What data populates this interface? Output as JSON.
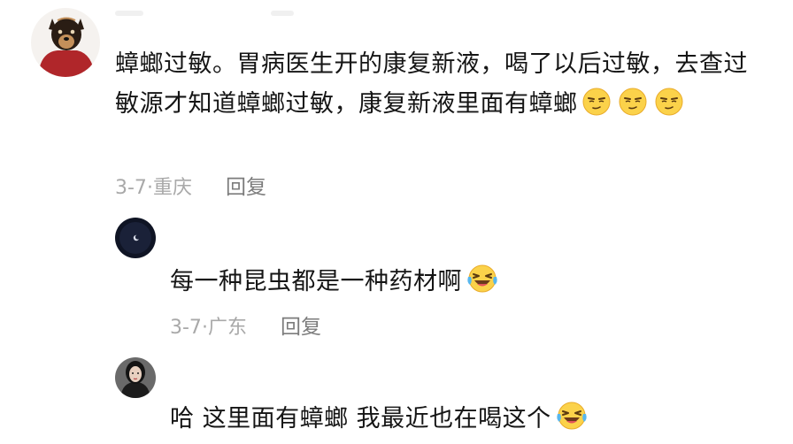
{
  "comments": [
    {
      "avatar_icon": "dog-avatar-icon",
      "text": "蟑螂过敏。胃病医生开的康复新液，喝了以后过敏，去查过敏源才知道蟑螂过敏，康复新液里面有蟑螂",
      "emoji_icon": "smirk-emoji-icon",
      "date": "3-7",
      "location": "重庆",
      "reply_label": "回复"
    },
    {
      "avatar_icon": "dark-moon-avatar-icon",
      "text": "每一种昆虫都是一种药材啊",
      "emoji_icon": "laugh-cry-emoji-icon",
      "date": "3-7",
      "location": "广东",
      "reply_label": "回复"
    },
    {
      "avatar_icon": "woman-avatar-icon",
      "text": "哈 这里面有蟑螂 我最近也在喝这个",
      "emoji_icon": "laugh-cry-emoji-icon"
    }
  ],
  "separator": "·"
}
